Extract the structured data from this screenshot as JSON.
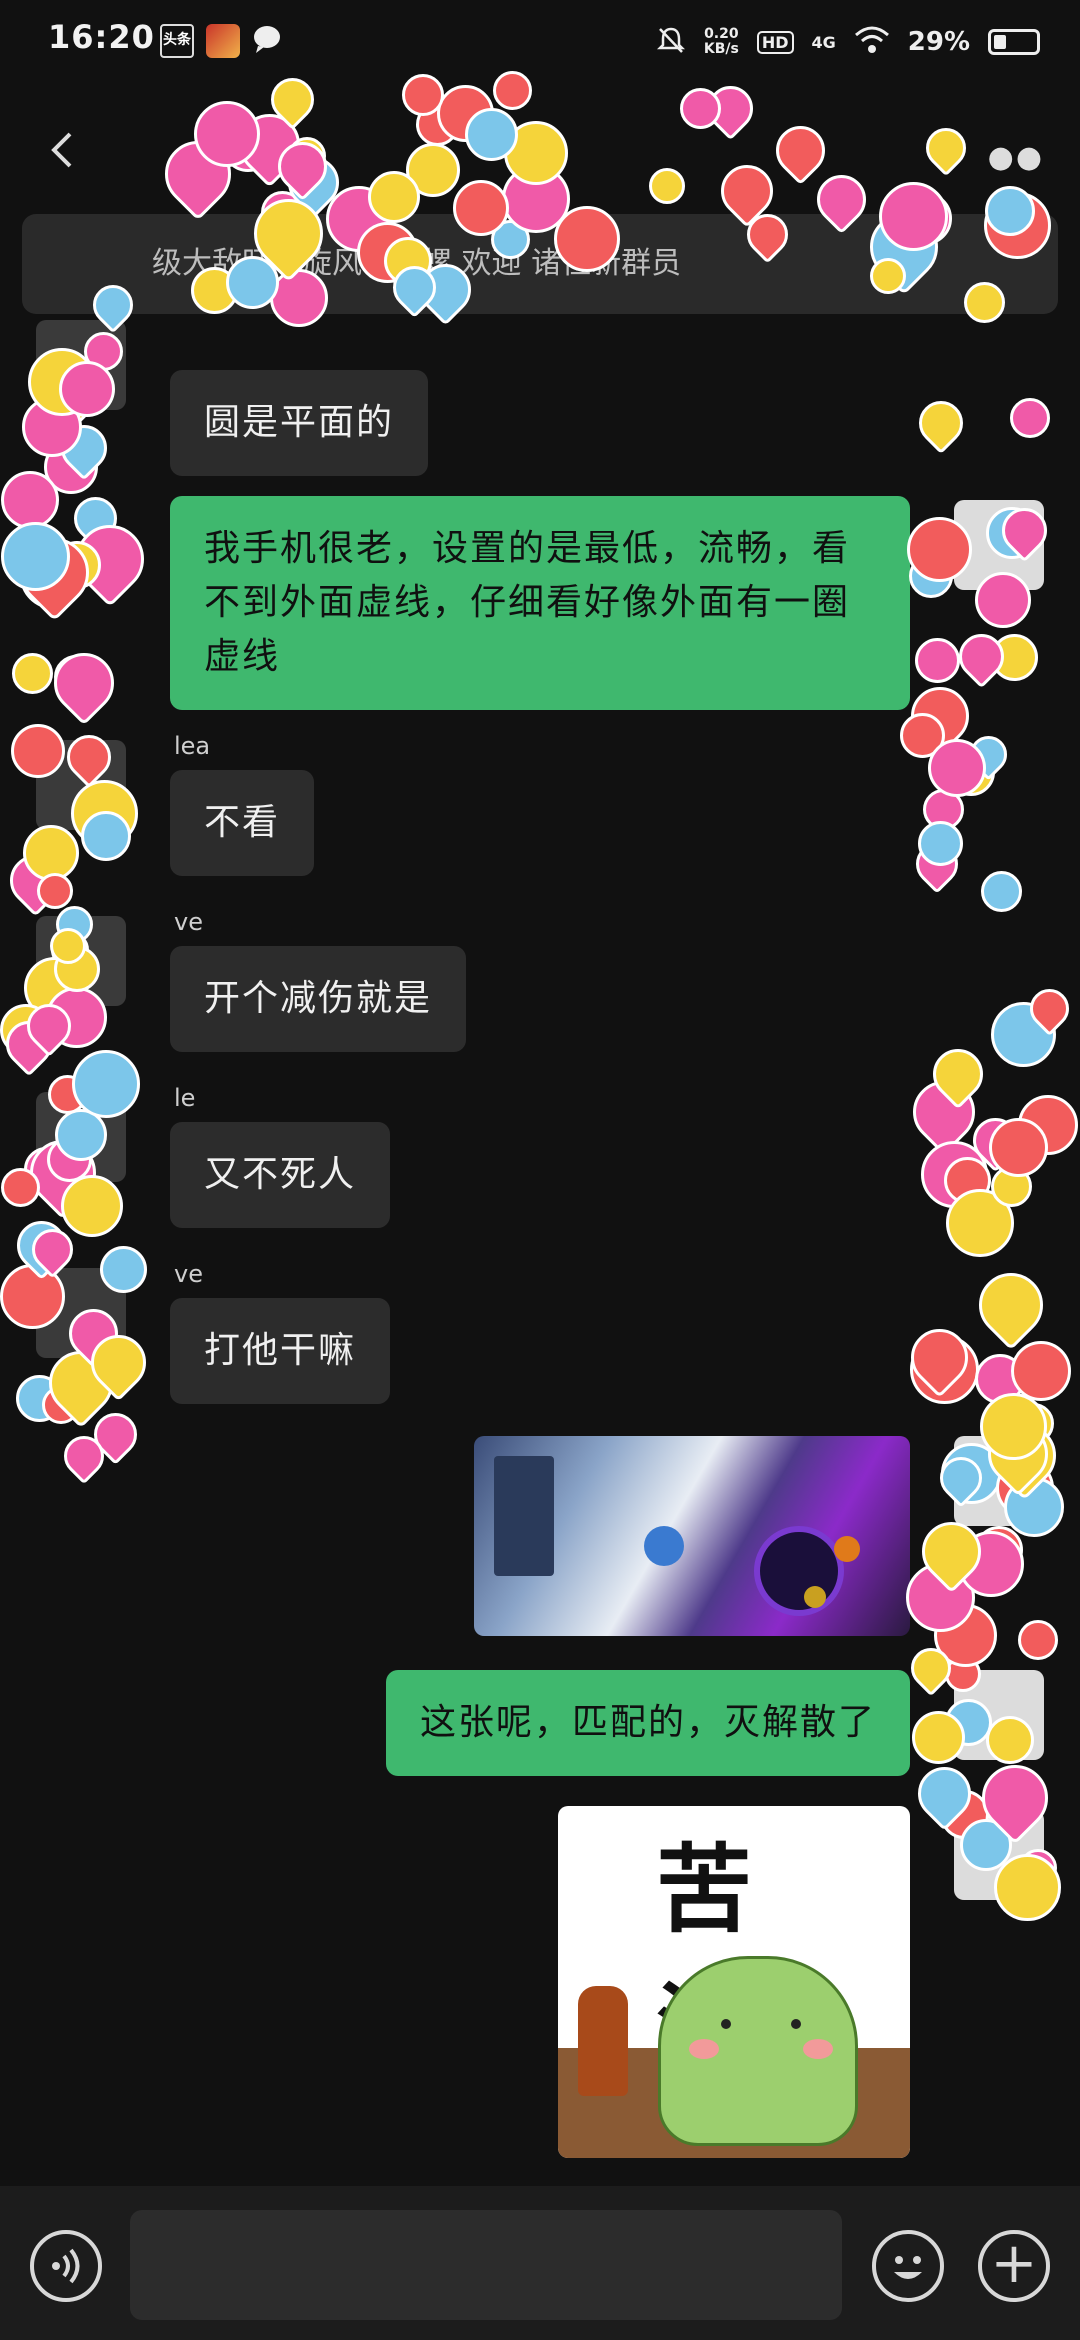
{
  "status_bar": {
    "time": "16:20",
    "toutiao": "头条",
    "net_speed_value": "0.20",
    "net_speed_unit": "KB/s",
    "hd": "HD",
    "signal": "4G",
    "battery_text": "29%",
    "battery_level": 0.29
  },
  "header": {
    "notice": "级大敌旺旺旋风小陀螺 欢迎 诸位新群员"
  },
  "messages": [
    {
      "dir": "in",
      "text": "圆是平面的"
    },
    {
      "dir": "out",
      "text": "我手机很老，设置的是最低，流畅，看不到外面虚线，仔细看好像外面有一圈虚线"
    },
    {
      "dir": "in",
      "sender": "lea",
      "text": "不看"
    },
    {
      "dir": "in",
      "sender": "ve",
      "text": "开个减伤就是"
    },
    {
      "dir": "in",
      "sender": "le",
      "text": "又不死人"
    },
    {
      "dir": "in",
      "sender": "ve",
      "text": "打他干嘛"
    },
    {
      "dir": "out",
      "type": "image",
      "desc": "game-screenshot"
    },
    {
      "dir": "out",
      "text": "这张呢，匹配的，灭解散了"
    },
    {
      "dir": "out",
      "type": "sticker",
      "text": "苦 涩"
    }
  ],
  "colors": {
    "background": "#111111",
    "bubble_in": "#2c2c2c",
    "bubble_out": "#3fb86e",
    "notice_bg": "#2a2a2a"
  },
  "bottom_bar": {
    "voice_icon": "voice-icon",
    "emoji_icon": "emoji-icon",
    "plus_icon": "plus-icon",
    "plus_glyph": "+"
  }
}
